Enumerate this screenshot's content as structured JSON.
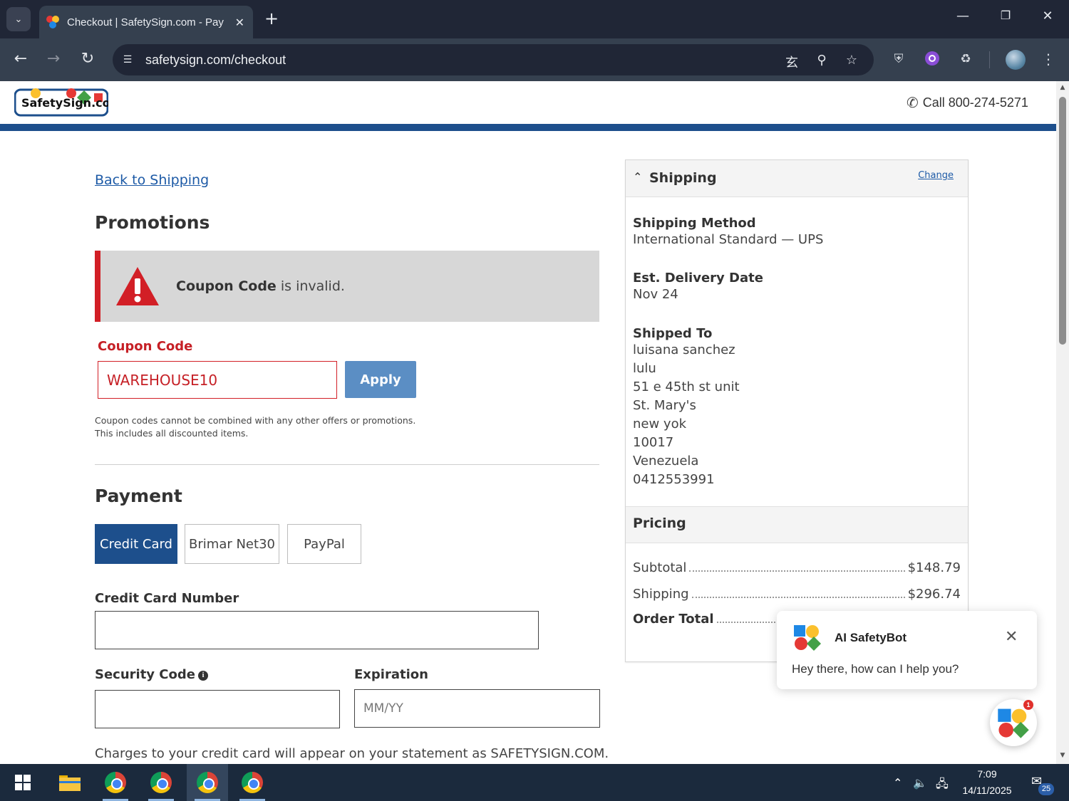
{
  "browser": {
    "tab_title": "Checkout | SafetySign.com - Pay",
    "url": "safetysign.com/checkout",
    "icons": [
      "tab-list-icon",
      "close-icon",
      "plus-icon",
      "minimize-icon",
      "restore-icon",
      "close-window-icon",
      "back-icon",
      "forward-icon",
      "reload-icon",
      "site-info-icon",
      "translate-icon",
      "key-icon",
      "star-icon",
      "shield-icon",
      "extension-icon",
      "puzzle-icon",
      "menu-icon"
    ]
  },
  "header": {
    "logo_text": "SafetySign.com",
    "phone": "Call 800-274-5271"
  },
  "promotions": {
    "back_link": "Back to Shipping",
    "title": "Promotions",
    "alert_bold": "Coupon Code",
    "alert_rest": " is invalid.",
    "coupon_label": "Coupon Code",
    "coupon_value": "WAREHOUSE10",
    "apply_label": "Apply",
    "note": "Coupon codes cannot be combined with any other offers or promotions. This includes all discounted items."
  },
  "payment": {
    "title": "Payment",
    "tabs": [
      "Credit Card",
      "Brimar Net30",
      "PayPal"
    ],
    "card_number_label": "Credit Card Number",
    "security_label": "Security Code",
    "expiration_label": "Expiration",
    "expiration_placeholder": "MM/YY",
    "charges_note": "Charges to your credit card will appear on your statement as SAFETYSIGN.COM."
  },
  "summary": {
    "shipping_title": "Shipping",
    "change_label": "Change",
    "method_label": "Shipping Method",
    "method_value": "International Standard — UPS",
    "delivery_label": "Est. Delivery Date",
    "delivery_value": "Nov 24",
    "shipped_to_label": "Shipped To",
    "address": [
      "luisana sanchez",
      "lulu",
      "51 e 45th st unit",
      "St. Mary's",
      "new yok",
      "10017",
      "Venezuela",
      "0412553991"
    ],
    "pricing_title": "Pricing",
    "subtotal_label": "Subtotal",
    "subtotal_value": "$148.79",
    "shipping_label": "Shipping",
    "shipping_value": "$296.74",
    "total_label": "Order Total"
  },
  "chat": {
    "name": "AI SafetyBot",
    "message": "Hey there, how can I help you?",
    "badge": "1"
  },
  "taskbar": {
    "time": "7:09",
    "date": "14/11/2025",
    "notifications": "25"
  },
  "colors": {
    "brand_blue": "#1d4f8c",
    "error_red": "#d21f26",
    "apply_blue": "#5b8ec4"
  }
}
